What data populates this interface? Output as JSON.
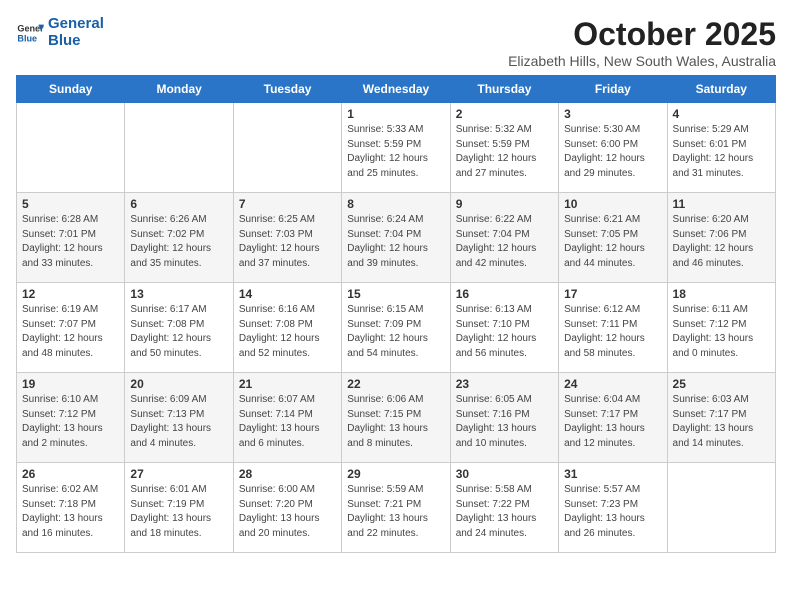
{
  "header": {
    "logo_line1": "General",
    "logo_line2": "Blue",
    "month": "October 2025",
    "location": "Elizabeth Hills, New South Wales, Australia"
  },
  "weekdays": [
    "Sunday",
    "Monday",
    "Tuesday",
    "Wednesday",
    "Thursday",
    "Friday",
    "Saturday"
  ],
  "weeks": [
    [
      {
        "day": "",
        "detail": ""
      },
      {
        "day": "",
        "detail": ""
      },
      {
        "day": "",
        "detail": ""
      },
      {
        "day": "1",
        "detail": "Sunrise: 5:33 AM\nSunset: 5:59 PM\nDaylight: 12 hours\nand 25 minutes."
      },
      {
        "day": "2",
        "detail": "Sunrise: 5:32 AM\nSunset: 5:59 PM\nDaylight: 12 hours\nand 27 minutes."
      },
      {
        "day": "3",
        "detail": "Sunrise: 5:30 AM\nSunset: 6:00 PM\nDaylight: 12 hours\nand 29 minutes."
      },
      {
        "day": "4",
        "detail": "Sunrise: 5:29 AM\nSunset: 6:01 PM\nDaylight: 12 hours\nand 31 minutes."
      }
    ],
    [
      {
        "day": "5",
        "detail": "Sunrise: 6:28 AM\nSunset: 7:01 PM\nDaylight: 12 hours\nand 33 minutes."
      },
      {
        "day": "6",
        "detail": "Sunrise: 6:26 AM\nSunset: 7:02 PM\nDaylight: 12 hours\nand 35 minutes."
      },
      {
        "day": "7",
        "detail": "Sunrise: 6:25 AM\nSunset: 7:03 PM\nDaylight: 12 hours\nand 37 minutes."
      },
      {
        "day": "8",
        "detail": "Sunrise: 6:24 AM\nSunset: 7:04 PM\nDaylight: 12 hours\nand 39 minutes."
      },
      {
        "day": "9",
        "detail": "Sunrise: 6:22 AM\nSunset: 7:04 PM\nDaylight: 12 hours\nand 42 minutes."
      },
      {
        "day": "10",
        "detail": "Sunrise: 6:21 AM\nSunset: 7:05 PM\nDaylight: 12 hours\nand 44 minutes."
      },
      {
        "day": "11",
        "detail": "Sunrise: 6:20 AM\nSunset: 7:06 PM\nDaylight: 12 hours\nand 46 minutes."
      }
    ],
    [
      {
        "day": "12",
        "detail": "Sunrise: 6:19 AM\nSunset: 7:07 PM\nDaylight: 12 hours\nand 48 minutes."
      },
      {
        "day": "13",
        "detail": "Sunrise: 6:17 AM\nSunset: 7:08 PM\nDaylight: 12 hours\nand 50 minutes."
      },
      {
        "day": "14",
        "detail": "Sunrise: 6:16 AM\nSunset: 7:08 PM\nDaylight: 12 hours\nand 52 minutes."
      },
      {
        "day": "15",
        "detail": "Sunrise: 6:15 AM\nSunset: 7:09 PM\nDaylight: 12 hours\nand 54 minutes."
      },
      {
        "day": "16",
        "detail": "Sunrise: 6:13 AM\nSunset: 7:10 PM\nDaylight: 12 hours\nand 56 minutes."
      },
      {
        "day": "17",
        "detail": "Sunrise: 6:12 AM\nSunset: 7:11 PM\nDaylight: 12 hours\nand 58 minutes."
      },
      {
        "day": "18",
        "detail": "Sunrise: 6:11 AM\nSunset: 7:12 PM\nDaylight: 13 hours\nand 0 minutes."
      }
    ],
    [
      {
        "day": "19",
        "detail": "Sunrise: 6:10 AM\nSunset: 7:12 PM\nDaylight: 13 hours\nand 2 minutes."
      },
      {
        "day": "20",
        "detail": "Sunrise: 6:09 AM\nSunset: 7:13 PM\nDaylight: 13 hours\nand 4 minutes."
      },
      {
        "day": "21",
        "detail": "Sunrise: 6:07 AM\nSunset: 7:14 PM\nDaylight: 13 hours\nand 6 minutes."
      },
      {
        "day": "22",
        "detail": "Sunrise: 6:06 AM\nSunset: 7:15 PM\nDaylight: 13 hours\nand 8 minutes."
      },
      {
        "day": "23",
        "detail": "Sunrise: 6:05 AM\nSunset: 7:16 PM\nDaylight: 13 hours\nand 10 minutes."
      },
      {
        "day": "24",
        "detail": "Sunrise: 6:04 AM\nSunset: 7:17 PM\nDaylight: 13 hours\nand 12 minutes."
      },
      {
        "day": "25",
        "detail": "Sunrise: 6:03 AM\nSunset: 7:17 PM\nDaylight: 13 hours\nand 14 minutes."
      }
    ],
    [
      {
        "day": "26",
        "detail": "Sunrise: 6:02 AM\nSunset: 7:18 PM\nDaylight: 13 hours\nand 16 minutes."
      },
      {
        "day": "27",
        "detail": "Sunrise: 6:01 AM\nSunset: 7:19 PM\nDaylight: 13 hours\nand 18 minutes."
      },
      {
        "day": "28",
        "detail": "Sunrise: 6:00 AM\nSunset: 7:20 PM\nDaylight: 13 hours\nand 20 minutes."
      },
      {
        "day": "29",
        "detail": "Sunrise: 5:59 AM\nSunset: 7:21 PM\nDaylight: 13 hours\nand 22 minutes."
      },
      {
        "day": "30",
        "detail": "Sunrise: 5:58 AM\nSunset: 7:22 PM\nDaylight: 13 hours\nand 24 minutes."
      },
      {
        "day": "31",
        "detail": "Sunrise: 5:57 AM\nSunset: 7:23 PM\nDaylight: 13 hours\nand 26 minutes."
      },
      {
        "day": "",
        "detail": ""
      }
    ]
  ]
}
